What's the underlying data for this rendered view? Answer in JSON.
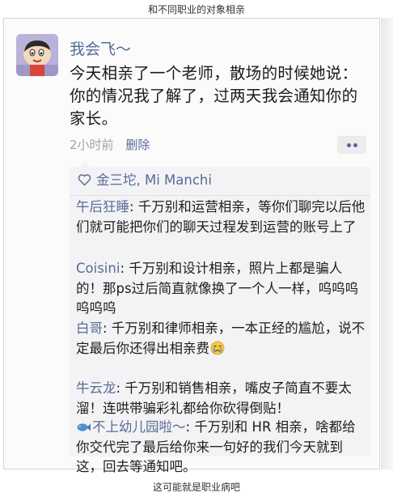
{
  "header": {
    "caption": "和不同职业的对象相亲"
  },
  "footer": {
    "caption": "这可能就是职业病吧"
  },
  "post": {
    "user": "我会飞～",
    "text": "今天相亲了一个老师，散场的时候她说：你的情况我了解了，过两天我会通知你的家长。",
    "time": "2小时前",
    "delete_label": "删除"
  },
  "likes": {
    "names": "金三坨, Mi Manchi"
  },
  "comments": [
    {
      "name": "午后狂睡",
      "text": ": 千万别和运营相亲，等你们聊完以后他们就可能把你们的聊天过程发到运营的账号上了"
    },
    {
      "name": "Coisini",
      "text": ": 千万别和设计相亲，照片上都是骗人的！那ps过后简直就像换了一个人一样，呜呜呜呜呜呜"
    },
    {
      "name": "白哥",
      "text": ": 千万别和律师相亲，一本正经的尴尬，说不定最后你还得出相亲费"
    },
    {
      "name": "牛云龙",
      "text": ": 千万别和销售相亲，嘴皮子简直不要太溜！连哄带骗彩礼都给你砍得倒贴！"
    },
    {
      "name": "不上幼儿园啦～",
      "text": ": 千万别和 HR 相亲，啥都给你交代完了最后给你来一句好的我们今天就到这，回去等通知吧。"
    }
  ],
  "colors": {
    "link": "#576b95",
    "timestamp": "#a3a3a3",
    "comment_bg": "#f3f3f5"
  },
  "icons": [
    "avatar-cartoon",
    "heart-outline-icon",
    "crying-emoji-icon",
    "fish-emoji-icon",
    "more-dots-icon"
  ]
}
